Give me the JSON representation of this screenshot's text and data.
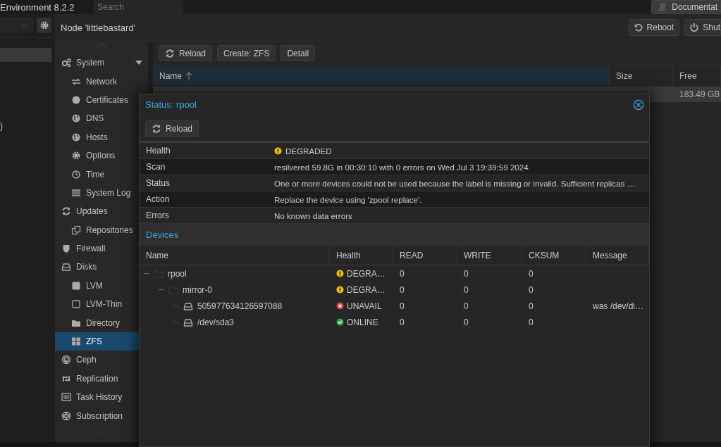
{
  "header": {
    "title": "Environment 8.2.2",
    "search": {
      "placeholder": "Search"
    },
    "buttons": [
      {
        "label": "Documentat"
      }
    ]
  },
  "resource_tree": {
    "rows": [
      {
        "selected": true
      },
      {
        "selected": false,
        "label": ")"
      }
    ]
  },
  "node": {
    "title": "Node 'littlebastard'",
    "buttons": [
      {
        "label": "Reboot"
      },
      {
        "label": "Shut"
      }
    ]
  },
  "nav": {
    "items": [
      {
        "label": "System",
        "selected": false,
        "dropdown": true,
        "children": [
          {
            "label": "Network",
            "selected": false
          },
          {
            "label": "Certificates",
            "selected": false
          },
          {
            "label": "DNS",
            "selected": false
          },
          {
            "label": "Hosts",
            "selected": false
          },
          {
            "label": "Options",
            "selected": false
          },
          {
            "label": "Time",
            "selected": false
          },
          {
            "label": "System Log",
            "selected": false
          }
        ]
      },
      {
        "label": "Updates",
        "selected": false,
        "dropdown": false,
        "children": [
          {
            "label": "Repositories",
            "selected": false
          }
        ]
      },
      {
        "label": "Firewall",
        "selected": false,
        "dropdown": false
      },
      {
        "label": "Disks",
        "selected": false,
        "dropdown": false,
        "children": [
          {
            "label": "LVM",
            "selected": false
          },
          {
            "label": "LVM-Thin",
            "selected": false
          },
          {
            "label": "Directory",
            "selected": false
          },
          {
            "label": "ZFS",
            "selected": true
          }
        ]
      },
      {
        "label": "Ceph",
        "selected": false,
        "dropdown": false
      },
      {
        "label": "Replication",
        "selected": false,
        "dropdown": false
      },
      {
        "label": "Task History",
        "selected": false,
        "dropdown": false
      },
      {
        "label": "Subscription",
        "selected": false,
        "dropdown": false
      }
    ]
  },
  "zfs": {
    "toolbar": [
      "Reload",
      "Create: ZFS",
      "Detail"
    ],
    "columns": [
      {
        "label": "Name",
        "sorted": true
      },
      {
        "label": "Size",
        "sorted": false
      },
      {
        "label": "Free",
        "sorted": false
      }
    ],
    "rows": [
      {
        "free": "183.49 GB",
        "selected": true
      }
    ]
  },
  "status_dialog": {
    "title": "Status: rpool",
    "toolbar": [
      "Reload"
    ],
    "properties": [
      {
        "key": "Health",
        "value": "DEGRADED",
        "color": "#f0c000"
      },
      {
        "key": "Scan",
        "value": "resilvered 59.8G in 00:30:10 with 0 errors on Wed Jul 3 19:39:59 2024"
      },
      {
        "key": "Status",
        "value": "One or more devices could not be used because the label is missing or invalid. Sufficient replicas …"
      },
      {
        "key": "Action",
        "value": "Replace the device using 'zpool replace'."
      },
      {
        "key": "Errors",
        "value": "No known data errors"
      }
    ],
    "devices": {
      "title": "Devices",
      "columns": [
        "Name",
        "Health",
        "READ",
        "WRITE",
        "CKSUM",
        "Message"
      ],
      "rows": [
        {
          "name": "rpool",
          "kind": "pool",
          "health": "DEGRA…",
          "color": "#f0c000",
          "read": "0",
          "write": "0",
          "cksum": "0",
          "expanded": true,
          "children": [
            {
              "name": "mirror-0",
              "kind": "vdev",
              "health": "DEGRA…",
              "color": "#f0c000",
              "read": "0",
              "write": "0",
              "cksum": "0",
              "expanded": true,
              "children": [
                {
                  "name": "505977634126597088",
                  "kind": "disk",
                  "health": "UNAVAIL",
                  "color": "#e0444a",
                  "read": "0",
                  "write": "0",
                  "cksum": "0",
                  "message": "was /dev/di…"
                },
                {
                  "name": "/dev/sda3",
                  "kind": "disk",
                  "health": "ONLINE",
                  "color": "#22b14c",
                  "read": "0",
                  "write": "0",
                  "cksum": "0"
                }
              ]
            }
          ]
        }
      ]
    }
  }
}
